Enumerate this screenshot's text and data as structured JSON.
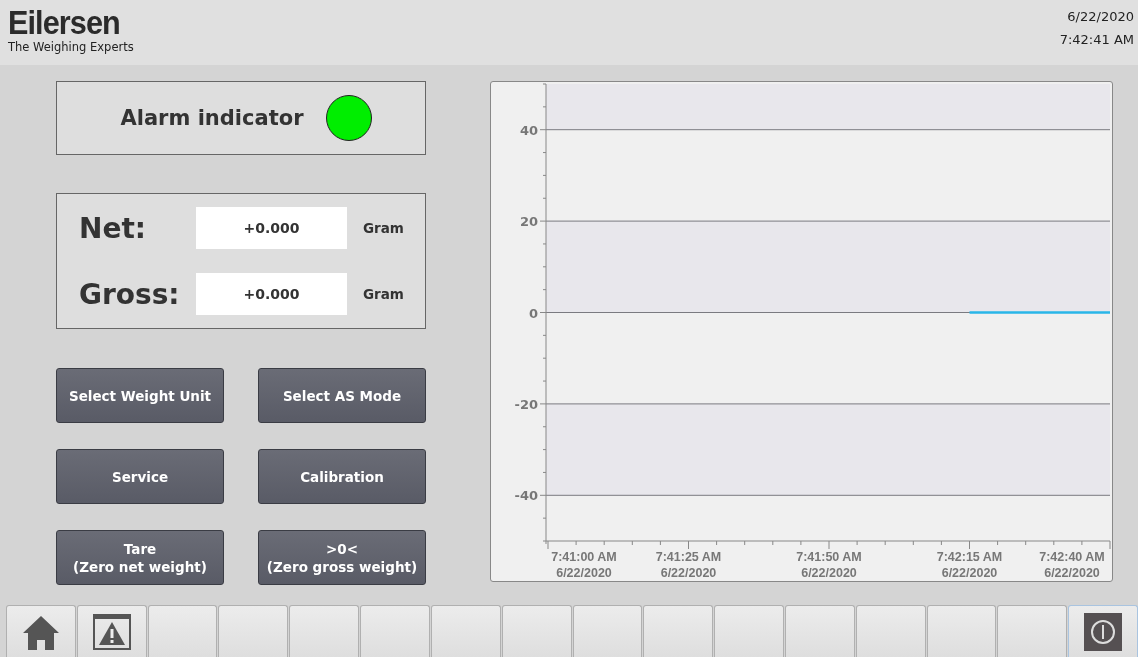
{
  "header": {
    "logo": "Eilersen",
    "tagline": "The Weighing Experts",
    "date": "6/22/2020",
    "time": "7:42:41 AM"
  },
  "alarm": {
    "label": "Alarm indicator",
    "color": "#00ee00"
  },
  "readings": [
    {
      "label": "Net:",
      "value": "+0.000",
      "unit": "Gram"
    },
    {
      "label": "Gross:",
      "value": "+0.000",
      "unit": "Gram"
    }
  ],
  "buttons": [
    "Select Weight Unit",
    "Select AS Mode",
    "Service",
    "Calibration",
    "Tare\n(Zero net weight)",
    ">0<\n(Zero gross weight)"
  ],
  "trend": {
    "chart_data": {
      "type": "line",
      "grid": true,
      "ylim": [
        -50,
        50
      ],
      "yticks": [
        40,
        20,
        0,
        -20,
        -40
      ],
      "categories": [
        "7:41:00 AM\n6/22/2020",
        "7:41:25 AM\n6/22/2020",
        "7:41:50 AM\n6/22/2020",
        "7:42:15 AM\n6/22/2020",
        "7:42:40 AM\n6/22/2020"
      ],
      "series": [
        {
          "color": "#29b6e8",
          "values": [
            null,
            null,
            null,
            0,
            0
          ]
        }
      ]
    }
  },
  "nav_buttons": [
    {
      "kind": "home"
    },
    {
      "kind": "alarm"
    },
    {
      "kind": "blank"
    },
    {
      "kind": "blank"
    },
    {
      "kind": "blank"
    },
    {
      "kind": "blank"
    },
    {
      "kind": "blank"
    },
    {
      "kind": "blank"
    },
    {
      "kind": "blank"
    },
    {
      "kind": "blank"
    },
    {
      "kind": "blank"
    },
    {
      "kind": "blank"
    },
    {
      "kind": "blank"
    },
    {
      "kind": "blank"
    },
    {
      "kind": "blank"
    },
    {
      "kind": "power"
    }
  ]
}
